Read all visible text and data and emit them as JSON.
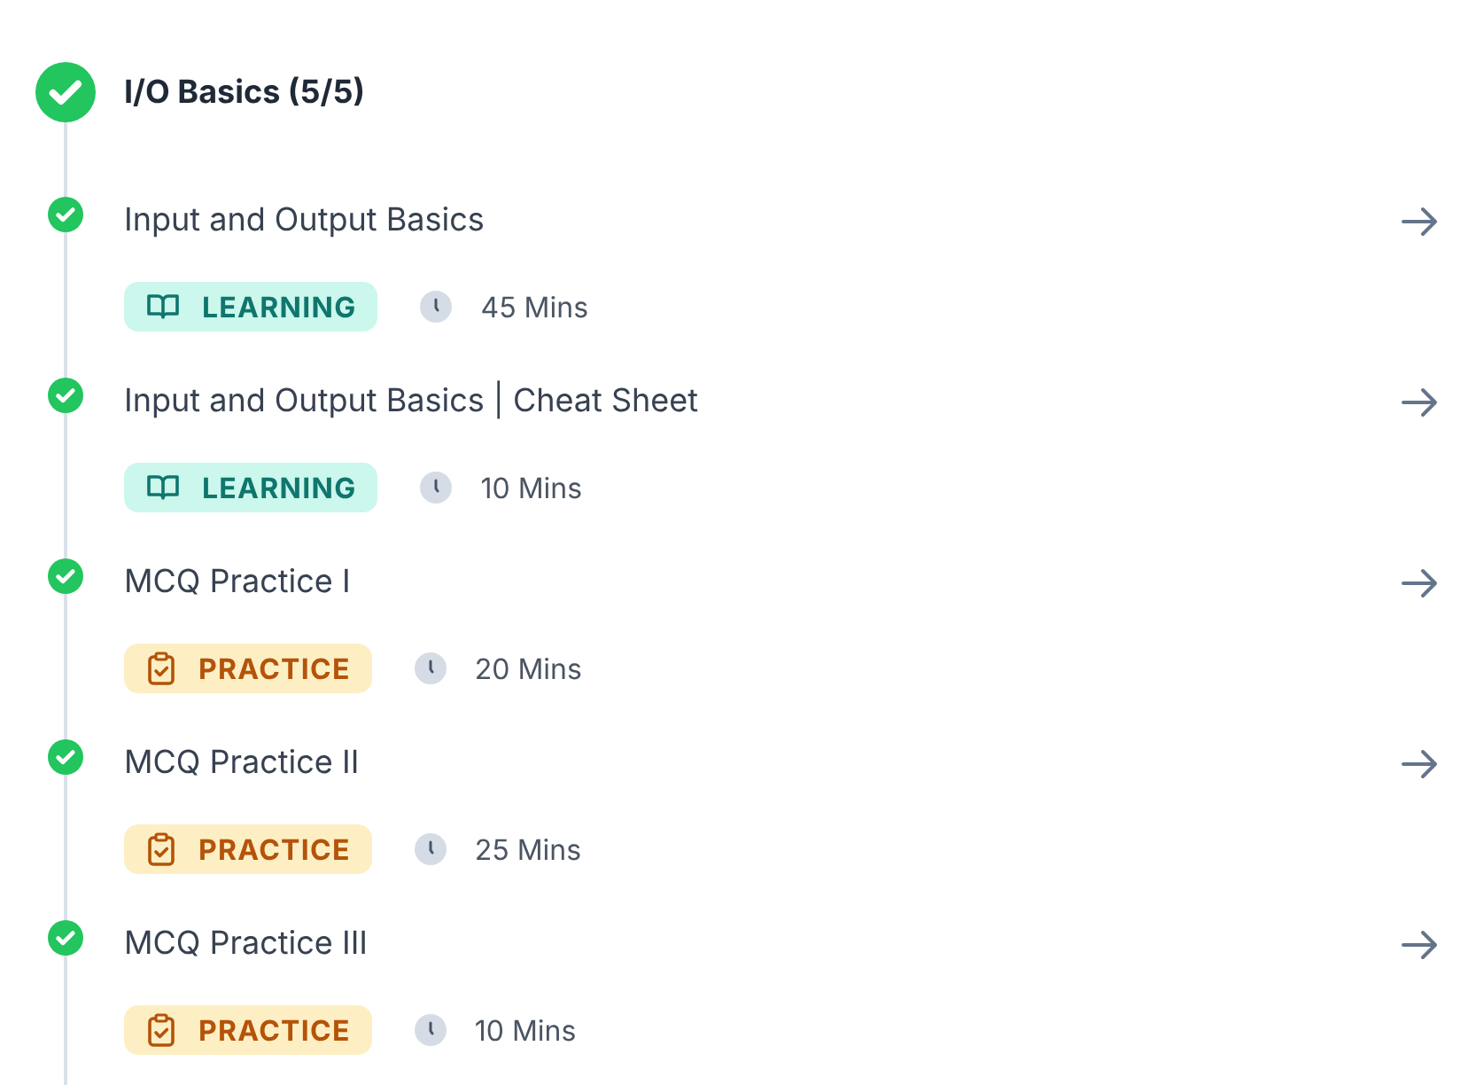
{
  "section": {
    "title": "I/O Basics (5/5)",
    "completed": true
  },
  "items": [
    {
      "title": "Input and Output Basics",
      "kind": "learning",
      "badge": "LEARNING",
      "duration": "45 Mins",
      "completed": true
    },
    {
      "title": "Input and Output Basics | Cheat Sheet",
      "kind": "learning",
      "badge": "LEARNING",
      "duration": "10 Mins",
      "completed": true
    },
    {
      "title": "MCQ Practice I",
      "kind": "practice",
      "badge": "PRACTICE",
      "duration": "20 Mins",
      "completed": true
    },
    {
      "title": "MCQ Practice II",
      "kind": "practice",
      "badge": "PRACTICE",
      "duration": "25 Mins",
      "completed": true
    },
    {
      "title": "MCQ Practice III",
      "kind": "practice",
      "badge": "PRACTICE",
      "duration": "10 Mins",
      "completed": true
    }
  ]
}
